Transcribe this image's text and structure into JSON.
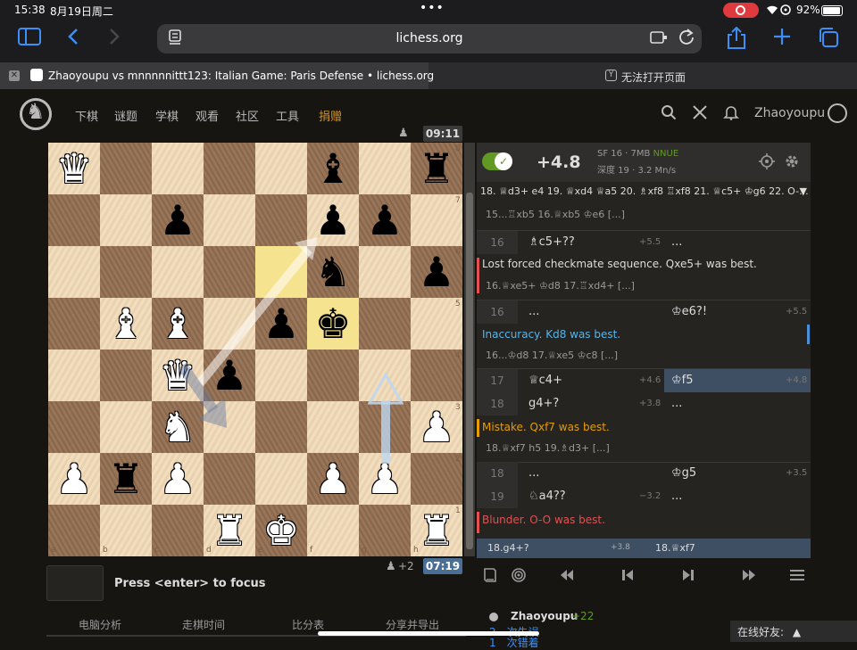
{
  "status_bar": {
    "time": "15:38",
    "date": "8月19日周二",
    "battery": "92%",
    "icons": "wifi-icon"
  },
  "browser": {
    "url": "lichess.org",
    "tabs": [
      {
        "title": "Zhaoyoupu vs mnnnnnittt123: Italian Game: Paris Defense • lichess.org",
        "active": true
      },
      {
        "title": "无法打开页面",
        "active": false
      }
    ],
    "tab2_favicon": "Y"
  },
  "header": {
    "nav": [
      "下棋",
      "谜题",
      "学棋",
      "观看",
      "社区",
      "工具"
    ],
    "donate": "捐赠",
    "username": "Zhaoyoupu"
  },
  "board": {
    "orientation": "white",
    "pieces": [
      {
        "sq": "a8",
        "p": "♛",
        "c": "w"
      },
      {
        "sq": "f8",
        "p": "♝",
        "c": "b"
      },
      {
        "sq": "h8",
        "p": "♜",
        "c": "b"
      },
      {
        "sq": "c7",
        "p": "♟",
        "c": "b"
      },
      {
        "sq": "f7",
        "p": "♟",
        "c": "b"
      },
      {
        "sq": "g7",
        "p": "♟",
        "c": "b"
      },
      {
        "sq": "f6",
        "p": "♞",
        "c": "b"
      },
      {
        "sq": "h6",
        "p": "♟",
        "c": "b"
      },
      {
        "sq": "b5",
        "p": "♝",
        "c": "w"
      },
      {
        "sq": "c5",
        "p": "♝",
        "c": "w"
      },
      {
        "sq": "e5",
        "p": "♟",
        "c": "b"
      },
      {
        "sq": "f5",
        "p": "♚",
        "c": "b"
      },
      {
        "sq": "c4",
        "p": "♛",
        "c": "w"
      },
      {
        "sq": "d4",
        "p": "♟",
        "c": "b"
      },
      {
        "sq": "c3",
        "p": "♞",
        "c": "w"
      },
      {
        "sq": "h3",
        "p": "♟",
        "c": "w"
      },
      {
        "sq": "a2",
        "p": "♟",
        "c": "w"
      },
      {
        "sq": "b2",
        "p": "♜",
        "c": "b"
      },
      {
        "sq": "c2",
        "p": "♟",
        "c": "w"
      },
      {
        "sq": "f2",
        "p": "♟",
        "c": "w"
      },
      {
        "sq": "g2",
        "p": "♟",
        "c": "w"
      },
      {
        "sq": "d1",
        "p": "♜",
        "c": "w"
      },
      {
        "sq": "e1",
        "p": "♚",
        "c": "w"
      },
      {
        "sq": "h1",
        "p": "♜",
        "c": "w"
      }
    ],
    "highlight": [
      "e6",
      "f5"
    ],
    "files": [
      "a",
      "b",
      "c",
      "d",
      "e",
      "f",
      "g",
      "h"
    ],
    "ranks": [
      "8",
      "7",
      "6",
      "5",
      "4",
      "3",
      "2",
      "1"
    ]
  },
  "clocks": {
    "top": "09:11",
    "bottom": "07:19",
    "bottom_diff": "+2"
  },
  "keyboard": {
    "hint": "Press <enter> to focus"
  },
  "bottom_tabs": [
    "电脑分析",
    "走棋时间",
    "比分表",
    "分享并导出"
  ],
  "ceval": {
    "eval": "+4.8",
    "engine": "SF 16 · 7MB",
    "nnue": "NNUE",
    "depth": "深度 19 · 3.2 Mn/s",
    "pv": "18. ♕d3+ e4 19. ♕xd4 ♕a5 20. ♗xf8 ♖xf8 21. ♕c5+ ♔g6 22. O-..."
  },
  "moves": {
    "sideline_top": "15...♖xb5 16.♕xb5 ♔e6 [...]",
    "m16w": {
      "idx": "16",
      "move": "♗c5+??",
      "eval": "+5.5",
      "black": "..."
    },
    "comment_blunder1": "Lost forced checkmate sequence. Qxe5+ was best.",
    "sideline_1": "16.♕xe5+ ♔d8 17.♖xd4+ [...]",
    "m16b": {
      "idx": "16",
      "white": "...",
      "move": "♔e6?!",
      "eval": "+5.5"
    },
    "comment_inacc": "Inaccuracy. Kd8 was best.",
    "sideline_2": "16...♔d8 17.♕xe5 ♔c8 [...]",
    "m17": {
      "idx": "17",
      "white": "♕c4+",
      "weval": "+4.6",
      "black": "♔f5",
      "beval": "+4.8"
    },
    "m18": {
      "idx": "18",
      "white": "g4+?",
      "weval": "+3.8",
      "black": "..."
    },
    "comment_mistake": "Mistake. Qxf7 was best.",
    "sideline_3": "18.♕xf7 h5 19.♗d3+ [...]",
    "m18b": {
      "idx": "18",
      "white": "...",
      "black": "♔g5",
      "beval": "+3.5"
    },
    "m19": {
      "idx": "19",
      "white": "♘a4??",
      "weval": "−3.2",
      "black": "..."
    },
    "comment_blunder2": "Blunder. O-O was best."
  },
  "footer_moves": {
    "a": "18.g4+?",
    "a_eval": "+3.8",
    "b": "18.♕xf7"
  },
  "player": {
    "name": "Zhaoyoupu",
    "rating_diff": "+22",
    "sub1_n": "2",
    "sub1": "次失误",
    "sub2_n": "1",
    "sub2": "次错着"
  },
  "online": "在线好友:"
}
